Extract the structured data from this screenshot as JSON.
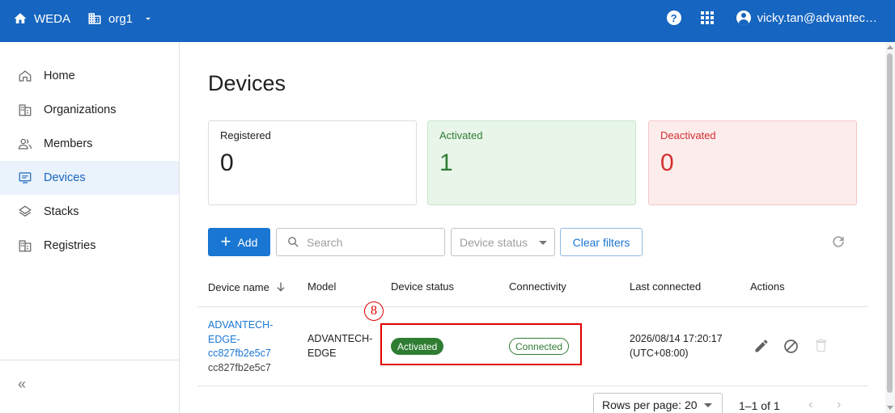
{
  "topbar": {
    "app_name": "WEDA",
    "home_icon": "home-icon",
    "org_icon": "building-icon",
    "org_name": "org1",
    "help_glyph": "?",
    "help_icon": "help-circle-icon",
    "apps_icon": "apps-grid-icon",
    "account_icon": "account-circle-icon",
    "user_email": "vicky.tan@advantec…",
    "bg_color": "#1665c0"
  },
  "sidebar": {
    "items": [
      {
        "label": "Home",
        "icon": "home-icon",
        "active": false
      },
      {
        "label": "Organizations",
        "icon": "building-icon",
        "active": false
      },
      {
        "label": "Members",
        "icon": "people-icon",
        "active": false
      },
      {
        "label": "Devices",
        "icon": "device-icon",
        "active": true
      },
      {
        "label": "Stacks",
        "icon": "layers-icon",
        "active": false
      },
      {
        "label": "Registries",
        "icon": "building-icon",
        "active": false
      }
    ],
    "collapse_glyph": "«",
    "collapse_icon": "collapse-chevrons-icon"
  },
  "main": {
    "title": "Devices",
    "stats": {
      "registered": {
        "label": "Registered",
        "value": "0"
      },
      "activated": {
        "label": "Activated",
        "value": "1",
        "color": "#2e7d32"
      },
      "deactivated": {
        "label": "Deactivated",
        "value": "0",
        "color": "#d32f2f"
      }
    },
    "toolbar": {
      "add_label": "Add",
      "add_glyph": "+",
      "search_placeholder": "Search",
      "status_placeholder": "Device status",
      "clear_label": "Clear filters",
      "refresh_icon": "refresh-icon"
    },
    "table": {
      "columns": [
        "Device name",
        "Model",
        "Device status",
        "Connectivity",
        "Last connected",
        "Actions"
      ],
      "rows": [
        {
          "name_line1": "ADVANTECH-",
          "name_line2": "EDGE-",
          "name_line3": "cc827fb2e5c7",
          "device_id": "cc827fb2e5c7",
          "model_line1": "ADVANTECH-",
          "model_line2": "EDGE",
          "status": "Activated",
          "connectivity": "Connected",
          "last_connected_line1": "2026/08/14 17:20:17",
          "last_connected_line2": "(UTC+08:00)"
        }
      ]
    },
    "annotation": {
      "step_number": "8",
      "color": "#e00000"
    },
    "pagination": {
      "rows_per_page_label": "Rows per page: 20",
      "page_info": "1–1 of 1",
      "prev_glyph": "‹",
      "next_glyph": "›"
    }
  }
}
